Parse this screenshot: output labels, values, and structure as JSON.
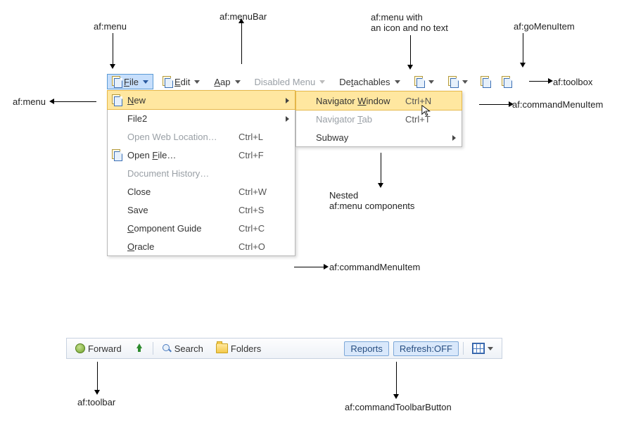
{
  "annotations": {
    "af_menu_top": "af:menu",
    "af_menubar": "af:menuBar",
    "af_menu_icon_only": "af:menu with\nan icon and no text",
    "af_gomenuitem": "af:goMenuItem",
    "af_menu_left": "af:menu",
    "af_toolbox": "af:toolbox",
    "af_commandmenuitem_right": "af:commandMenuItem",
    "nested_menu": "Nested\naf:menu components",
    "af_commandmenuitem_bottom": "af:commandMenuItem",
    "af_toolbar": "af:toolbar",
    "af_commandtoolbarbutton": "af:commandToolbarButton"
  },
  "menubar": {
    "file": "File",
    "edit": "Edit",
    "aap": "Aap",
    "disabled": "Disabled Menu",
    "detachables": "Detachables"
  },
  "file_menu": {
    "new": "New",
    "file2": "File2",
    "open_web": "Open Web Location…",
    "open_web_accel": "Ctrl+L",
    "open_file": "Open File…",
    "open_file_accel": "Ctrl+F",
    "doc_history": "Document History…",
    "close": "Close",
    "close_accel": "Ctrl+W",
    "save": "Save",
    "save_accel": "Ctrl+S",
    "comp_guide": "Component Guide",
    "comp_guide_accel": "Ctrl+C",
    "oracle": "Oracle",
    "oracle_accel": "Ctrl+O"
  },
  "submenu": {
    "nav_window": "Navigator Window",
    "nav_window_accel": "Ctrl+N",
    "nav_tab": "Navigator Tab",
    "nav_tab_accel": "Ctrl+T",
    "subway": "Subway"
  },
  "toolbar": {
    "forward": "Forward",
    "search": "Search",
    "folders": "Folders",
    "reports": "Reports",
    "refresh": "Refresh:OFF"
  }
}
